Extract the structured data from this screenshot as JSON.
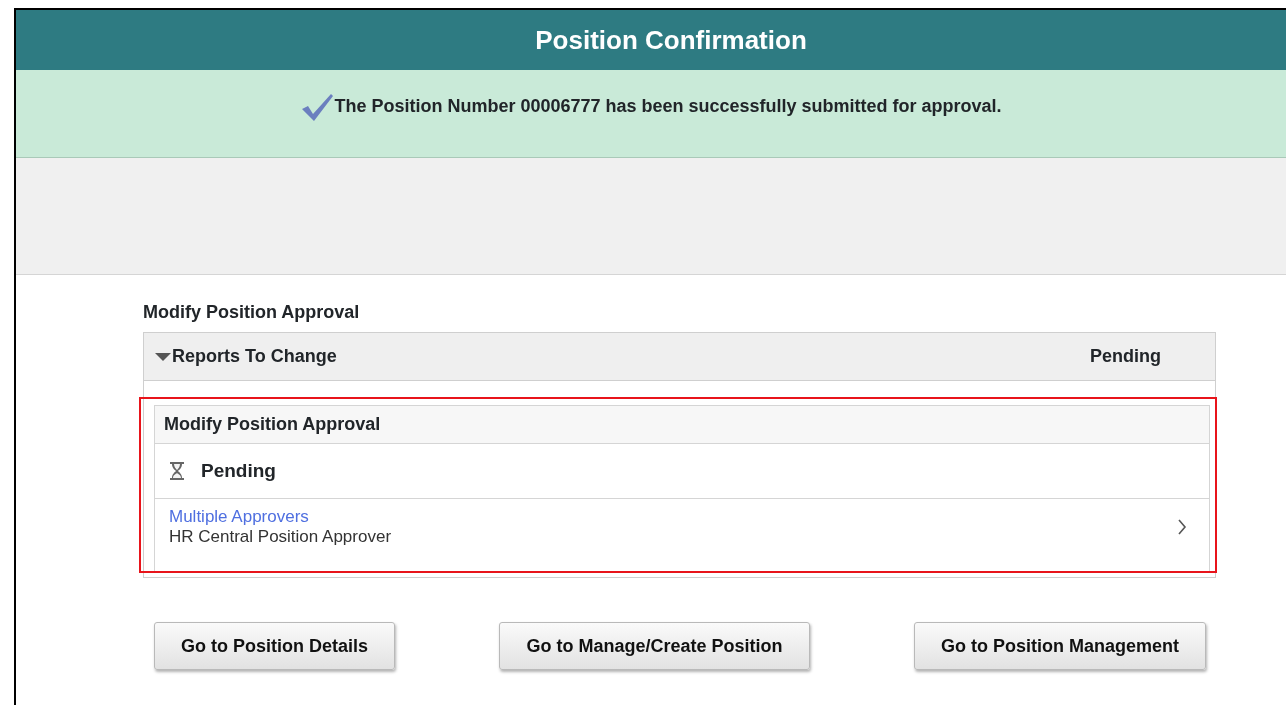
{
  "header": {
    "title": "Position Confirmation"
  },
  "message": {
    "text": "The Position Number 00006777 has been successfully submitted for approval."
  },
  "approval": {
    "title": "Modify Position Approval",
    "group": {
      "label": "Reports To Change",
      "status": "Pending",
      "expanded": true
    },
    "step": {
      "title": "Modify Position Approval",
      "highlighted": true,
      "status": "Pending",
      "approver": {
        "link": "Multiple Approvers",
        "role": "HR Central Position Approver"
      }
    }
  },
  "buttons": [
    "Go to Position Details",
    "Go to Manage/Create Position",
    "Go to Position Management"
  ]
}
